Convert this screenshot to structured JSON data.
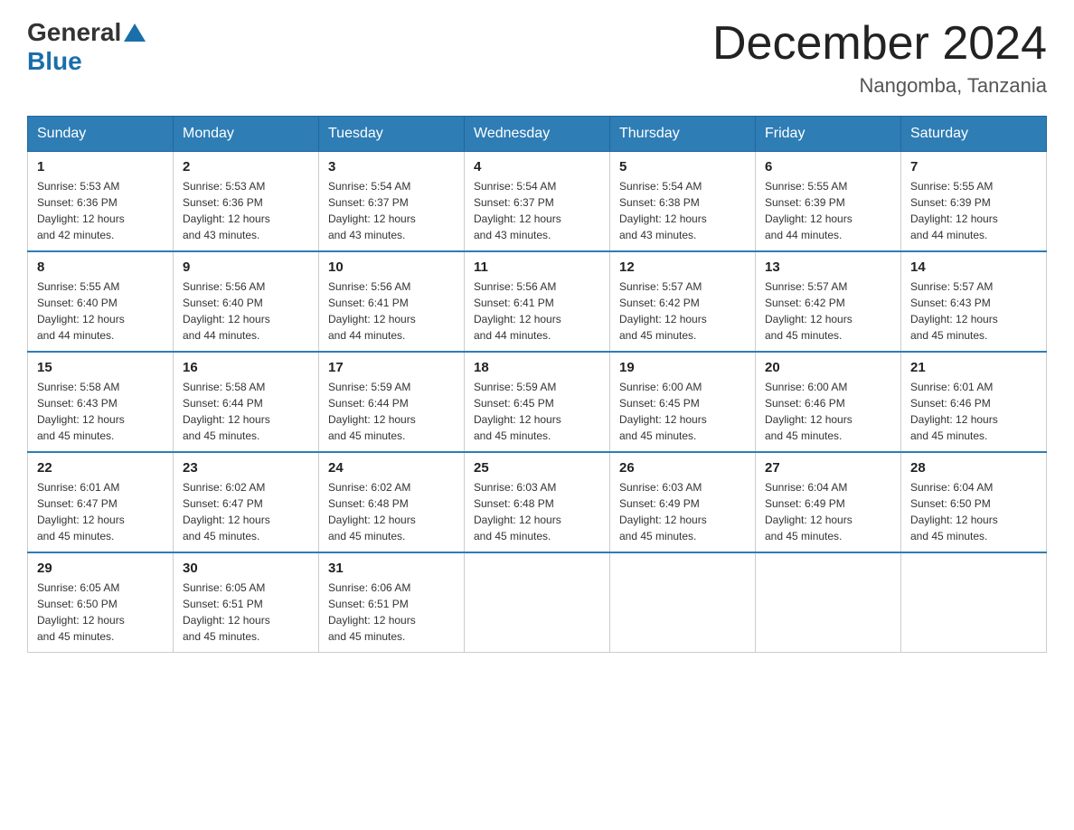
{
  "header": {
    "logo_general": "General",
    "logo_blue": "Blue",
    "month_title": "December 2024",
    "location": "Nangomba, Tanzania"
  },
  "weekdays": [
    "Sunday",
    "Monday",
    "Tuesday",
    "Wednesday",
    "Thursday",
    "Friday",
    "Saturday"
  ],
  "weeks": [
    [
      {
        "day": "1",
        "sunrise": "5:53 AM",
        "sunset": "6:36 PM",
        "daylight": "12 hours and 42 minutes."
      },
      {
        "day": "2",
        "sunrise": "5:53 AM",
        "sunset": "6:36 PM",
        "daylight": "12 hours and 43 minutes."
      },
      {
        "day": "3",
        "sunrise": "5:54 AM",
        "sunset": "6:37 PM",
        "daylight": "12 hours and 43 minutes."
      },
      {
        "day": "4",
        "sunrise": "5:54 AM",
        "sunset": "6:37 PM",
        "daylight": "12 hours and 43 minutes."
      },
      {
        "day": "5",
        "sunrise": "5:54 AM",
        "sunset": "6:38 PM",
        "daylight": "12 hours and 43 minutes."
      },
      {
        "day": "6",
        "sunrise": "5:55 AM",
        "sunset": "6:39 PM",
        "daylight": "12 hours and 44 minutes."
      },
      {
        "day": "7",
        "sunrise": "5:55 AM",
        "sunset": "6:39 PM",
        "daylight": "12 hours and 44 minutes."
      }
    ],
    [
      {
        "day": "8",
        "sunrise": "5:55 AM",
        "sunset": "6:40 PM",
        "daylight": "12 hours and 44 minutes."
      },
      {
        "day": "9",
        "sunrise": "5:56 AM",
        "sunset": "6:40 PM",
        "daylight": "12 hours and 44 minutes."
      },
      {
        "day": "10",
        "sunrise": "5:56 AM",
        "sunset": "6:41 PM",
        "daylight": "12 hours and 44 minutes."
      },
      {
        "day": "11",
        "sunrise": "5:56 AM",
        "sunset": "6:41 PM",
        "daylight": "12 hours and 44 minutes."
      },
      {
        "day": "12",
        "sunrise": "5:57 AM",
        "sunset": "6:42 PM",
        "daylight": "12 hours and 45 minutes."
      },
      {
        "day": "13",
        "sunrise": "5:57 AM",
        "sunset": "6:42 PM",
        "daylight": "12 hours and 45 minutes."
      },
      {
        "day": "14",
        "sunrise": "5:57 AM",
        "sunset": "6:43 PM",
        "daylight": "12 hours and 45 minutes."
      }
    ],
    [
      {
        "day": "15",
        "sunrise": "5:58 AM",
        "sunset": "6:43 PM",
        "daylight": "12 hours and 45 minutes."
      },
      {
        "day": "16",
        "sunrise": "5:58 AM",
        "sunset": "6:44 PM",
        "daylight": "12 hours and 45 minutes."
      },
      {
        "day": "17",
        "sunrise": "5:59 AM",
        "sunset": "6:44 PM",
        "daylight": "12 hours and 45 minutes."
      },
      {
        "day": "18",
        "sunrise": "5:59 AM",
        "sunset": "6:45 PM",
        "daylight": "12 hours and 45 minutes."
      },
      {
        "day": "19",
        "sunrise": "6:00 AM",
        "sunset": "6:45 PM",
        "daylight": "12 hours and 45 minutes."
      },
      {
        "day": "20",
        "sunrise": "6:00 AM",
        "sunset": "6:46 PM",
        "daylight": "12 hours and 45 minutes."
      },
      {
        "day": "21",
        "sunrise": "6:01 AM",
        "sunset": "6:46 PM",
        "daylight": "12 hours and 45 minutes."
      }
    ],
    [
      {
        "day": "22",
        "sunrise": "6:01 AM",
        "sunset": "6:47 PM",
        "daylight": "12 hours and 45 minutes."
      },
      {
        "day": "23",
        "sunrise": "6:02 AM",
        "sunset": "6:47 PM",
        "daylight": "12 hours and 45 minutes."
      },
      {
        "day": "24",
        "sunrise": "6:02 AM",
        "sunset": "6:48 PM",
        "daylight": "12 hours and 45 minutes."
      },
      {
        "day": "25",
        "sunrise": "6:03 AM",
        "sunset": "6:48 PM",
        "daylight": "12 hours and 45 minutes."
      },
      {
        "day": "26",
        "sunrise": "6:03 AM",
        "sunset": "6:49 PM",
        "daylight": "12 hours and 45 minutes."
      },
      {
        "day": "27",
        "sunrise": "6:04 AM",
        "sunset": "6:49 PM",
        "daylight": "12 hours and 45 minutes."
      },
      {
        "day": "28",
        "sunrise": "6:04 AM",
        "sunset": "6:50 PM",
        "daylight": "12 hours and 45 minutes."
      }
    ],
    [
      {
        "day": "29",
        "sunrise": "6:05 AM",
        "sunset": "6:50 PM",
        "daylight": "12 hours and 45 minutes."
      },
      {
        "day": "30",
        "sunrise": "6:05 AM",
        "sunset": "6:51 PM",
        "daylight": "12 hours and 45 minutes."
      },
      {
        "day": "31",
        "sunrise": "6:06 AM",
        "sunset": "6:51 PM",
        "daylight": "12 hours and 45 minutes."
      },
      null,
      null,
      null,
      null
    ]
  ],
  "labels": {
    "sunrise": "Sunrise:",
    "sunset": "Sunset:",
    "daylight": "Daylight:"
  }
}
